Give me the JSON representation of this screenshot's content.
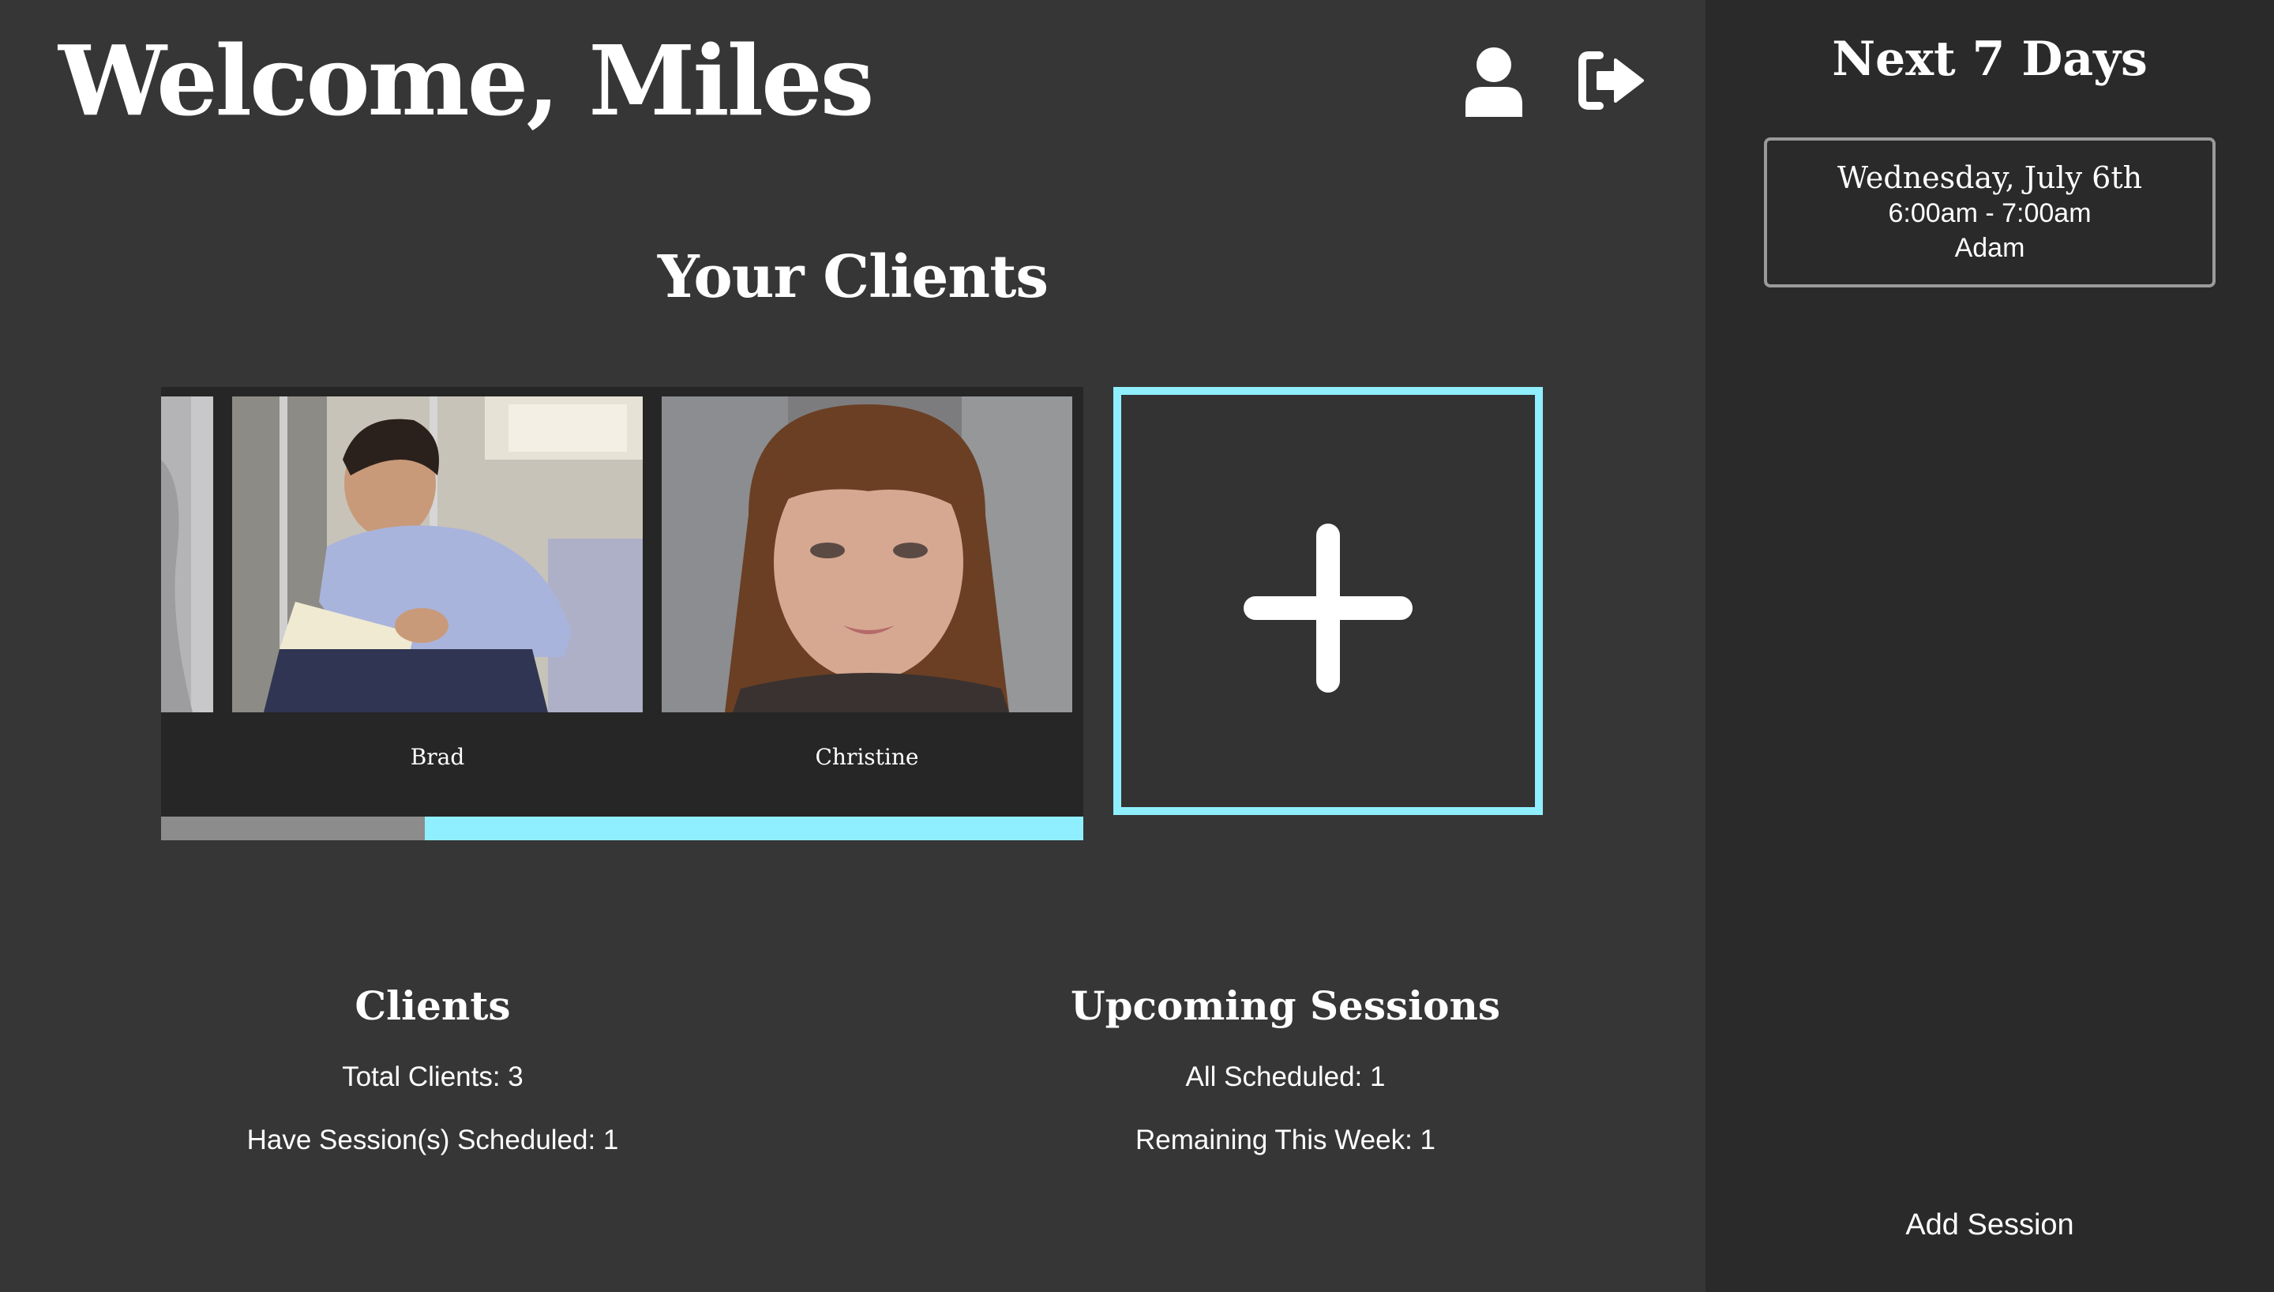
{
  "header": {
    "welcome": "Welcome, Miles",
    "profile_icon": "user-icon",
    "logout_icon": "sign-out-icon"
  },
  "clients_section": {
    "heading": "Your Clients",
    "cards": [
      {
        "name": ""
      },
      {
        "name": "Brad"
      },
      {
        "name": "Christine"
      }
    ],
    "scrollbar_position": 0.28,
    "add_icon": "plus-icon"
  },
  "stats": {
    "clients": {
      "title": "Clients",
      "total": "Total Clients: 3",
      "scheduled": "Have Session(s) Scheduled: 1"
    },
    "sessions": {
      "title": "Upcoming Sessions",
      "all": "All Scheduled: 1",
      "remaining": "Remaining This Week: 1"
    }
  },
  "sidebar": {
    "title": "Next 7 Days",
    "sessions": [
      {
        "date": "Wednesday, July 6th",
        "time": "6:00am - 7:00am",
        "client": "Adam"
      }
    ],
    "add_session": "Add Session"
  },
  "colors": {
    "accent": "#8fefff",
    "background": "#363636",
    "sidebar": "#2a2a2a",
    "card_bg": "#262626"
  }
}
